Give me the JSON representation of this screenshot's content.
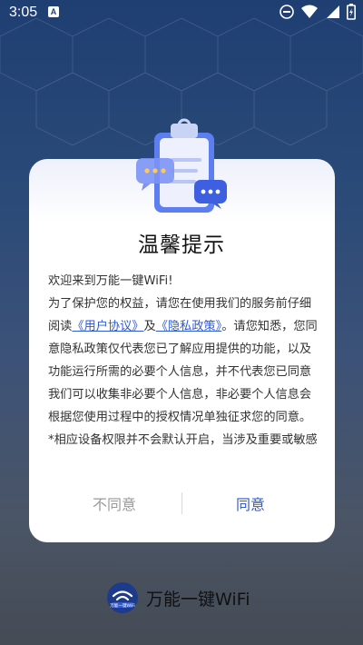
{
  "status_bar": {
    "time": "3:05",
    "notification_badge": "A",
    "icons": [
      "do-not-disturb-icon",
      "wifi-icon",
      "signal-icon",
      "battery-charging-icon"
    ]
  },
  "dialog": {
    "title": "温馨提示",
    "paragraphs": {
      "p1": "欢迎来到万能一键WiFi!",
      "p2_intro": "为了保护您的权益，请您在使用我们的服务前仔细阅读",
      "p2_link1": "《用户协议》",
      "p2_and": "及",
      "p2_link2": "《隐私政策》",
      "p2_rest": "。请您知悉，您同意隐私政策仅代表您已了解应用提供的功能，以及功能运行所需的必要个人信息，并不代表您已同意我们可以收集非必要个人信息，非必要个人信息会根据您使用过程中的授权情况单独征求您的同意。",
      "p3": "*相应设备权限并不会默认开启，当涉及重要或敏感"
    },
    "buttons": {
      "disagree": "不同意",
      "agree": "同意"
    }
  },
  "brand": {
    "name": "万能一键WiFi",
    "logo_text": "万能一键WiFi"
  },
  "colors": {
    "accent": "#2f5ad3",
    "disabled": "#9a9a9a"
  }
}
